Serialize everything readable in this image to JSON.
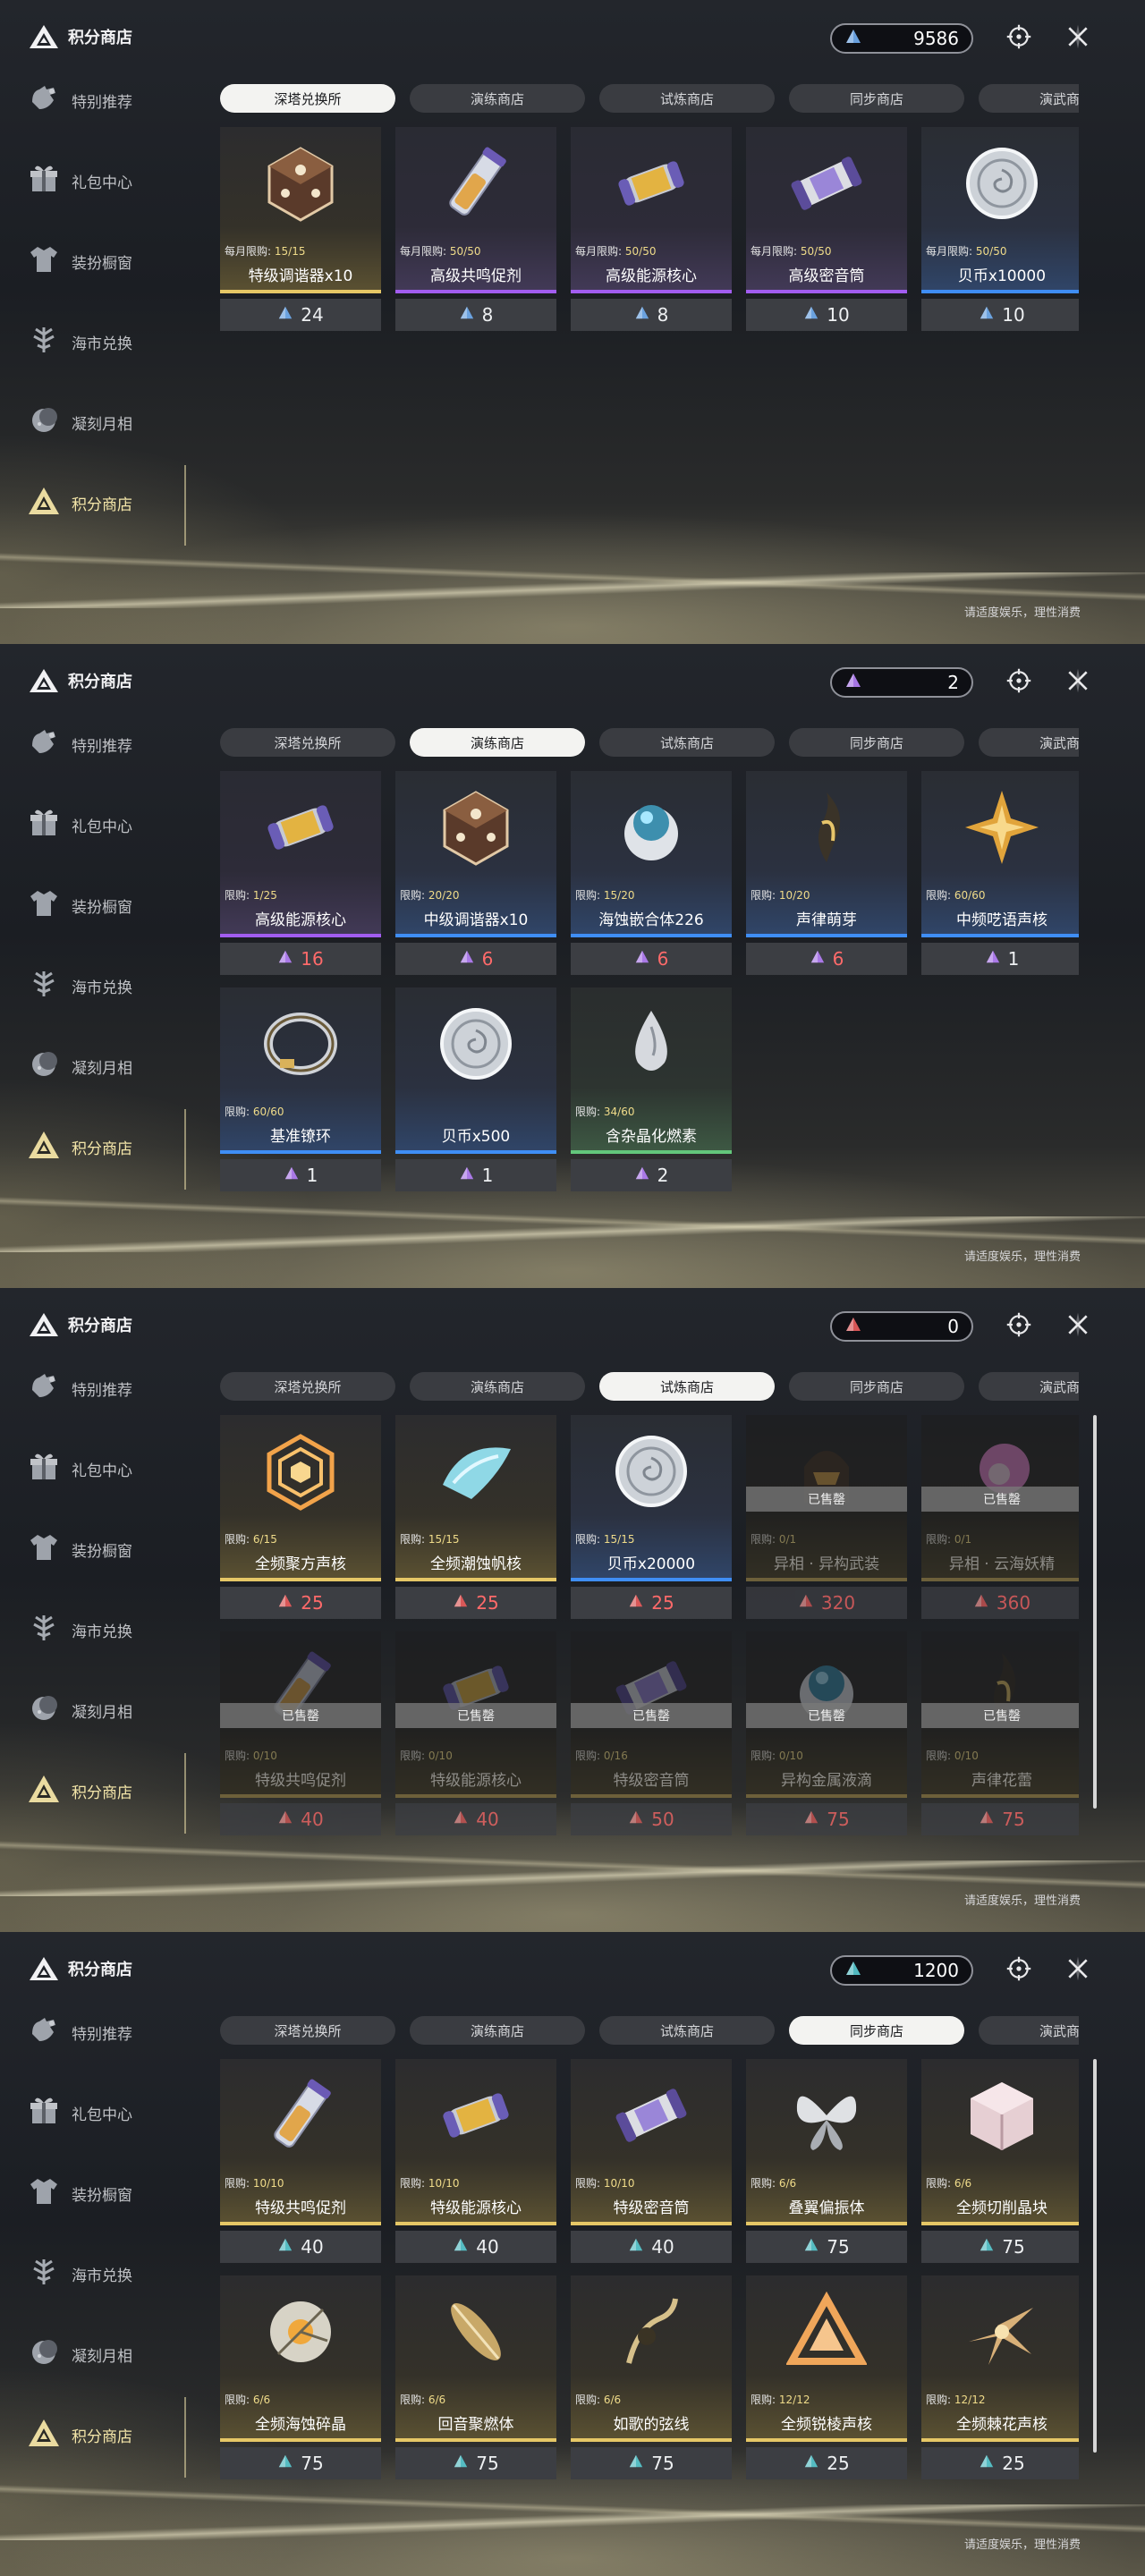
{
  "app": {
    "title": "积分商店",
    "footer": "请适度娱乐，理性消费",
    "sidebar": [
      {
        "label": "特别推荐",
        "icon": "hand-icon"
      },
      {
        "label": "礼包中心",
        "icon": "gift-icon"
      },
      {
        "label": "装扮橱窗",
        "icon": "shirt-icon"
      },
      {
        "label": "海市兑换",
        "icon": "tree-icon"
      },
      {
        "label": "凝刻月相",
        "icon": "moon-icon"
      },
      {
        "label": "积分商店",
        "icon": "triangle-icon"
      }
    ],
    "tabs": [
      "深塔兑换所",
      "演练商店",
      "试炼商店",
      "同步商店",
      "演武商店"
    ],
    "sold_out_label": "已售罄"
  },
  "colors": {
    "blue_currency": "#6ea8e8",
    "purple_currency": "#b07cf0",
    "red_currency": "#e25a5a",
    "teal_currency": "#56c3c9"
  },
  "screens": [
    {
      "active_tab": 0,
      "currency": {
        "value": "9586",
        "color": "blue"
      },
      "items": [
        {
          "limit_label": "每月限购:",
          "limit": "15/15",
          "name": "特级调谐器x10",
          "price": "24",
          "rarity": "gold",
          "art": "dice"
        },
        {
          "limit_label": "每月限购:",
          "limit": "50/50",
          "name": "高级共鸣促剂",
          "price": "8",
          "rarity": "purple",
          "art": "vial"
        },
        {
          "limit_label": "每月限购:",
          "limit": "50/50",
          "name": "高级能源核心",
          "price": "8",
          "rarity": "purple",
          "art": "capsule"
        },
        {
          "limit_label": "每月限购:",
          "limit": "50/50",
          "name": "高级密音筒",
          "price": "10",
          "rarity": "purple",
          "art": "tube"
        },
        {
          "limit_label": "每月限购:",
          "limit": "50/50",
          "name": "贝币x10000",
          "price": "10",
          "rarity": "blue",
          "art": "coin"
        }
      ]
    },
    {
      "active_tab": 1,
      "currency": {
        "value": "2",
        "color": "purple"
      },
      "items": [
        {
          "limit_label": "限购:",
          "limit": "1/25",
          "name": "高级能源核心",
          "price": "16",
          "rarity": "purple",
          "art": "capsule",
          "red": true
        },
        {
          "limit_label": "限购:",
          "limit": "20/20",
          "name": "中级调谐器x10",
          "price": "6",
          "rarity": "blue",
          "art": "dice",
          "red": true
        },
        {
          "limit_label": "限购:",
          "limit": "15/20",
          "name": "海蚀嵌合体226",
          "price": "6",
          "rarity": "blue",
          "art": "orb",
          "red": true
        },
        {
          "limit_label": "限购:",
          "limit": "10/20",
          "name": "声律萌芽",
          "price": "6",
          "rarity": "blue",
          "art": "sprout",
          "red": true
        },
        {
          "limit_label": "限购:",
          "limit": "60/60",
          "name": "中频呓语声核",
          "price": "1",
          "rarity": "blue",
          "art": "star"
        },
        {
          "limit_label": "限购:",
          "limit": "60/60",
          "name": "基准镣环",
          "price": "1",
          "rarity": "blue",
          "art": "ring"
        },
        {
          "limit_label": "",
          "limit": "",
          "name": "贝币x500",
          "price": "1",
          "rarity": "blue",
          "art": "coin"
        },
        {
          "limit_label": "限购:",
          "limit": "34/60",
          "name": "含杂晶化燃素",
          "price": "2",
          "rarity": "green",
          "art": "drop"
        }
      ]
    },
    {
      "active_tab": 2,
      "currency": {
        "value": "0",
        "color": "red"
      },
      "items": [
        {
          "limit_label": "限购:",
          "limit": "6/15",
          "name": "全频聚方声核",
          "price": "25",
          "rarity": "gold",
          "art": "hex",
          "red": true
        },
        {
          "limit_label": "限购:",
          "limit": "15/15",
          "name": "全频潮蚀帆核",
          "price": "25",
          "rarity": "gold",
          "art": "shell",
          "red": true
        },
        {
          "limit_label": "限购:",
          "limit": "15/15",
          "name": "贝币x20000",
          "price": "25",
          "rarity": "blue",
          "art": "coin",
          "red": true
        },
        {
          "limit_label": "限购:",
          "limit": "0/1",
          "name": "异相 · 异构武装",
          "price": "320",
          "rarity": "gold",
          "art": "helmet",
          "red": true,
          "sold": true
        },
        {
          "limit_label": "限购:",
          "limit": "0/1",
          "name": "异相 · 云海妖精",
          "price": "360",
          "rarity": "gold",
          "art": "fairy",
          "red": true,
          "sold": true
        },
        {
          "limit_label": "限购:",
          "limit": "0/10",
          "name": "特级共鸣促剂",
          "price": "40",
          "rarity": "gold",
          "art": "vial",
          "red": true,
          "sold": true
        },
        {
          "limit_label": "限购:",
          "limit": "0/10",
          "name": "特级能源核心",
          "price": "40",
          "rarity": "gold",
          "art": "capsule",
          "red": true,
          "sold": true
        },
        {
          "limit_label": "限购:",
          "limit": "0/16",
          "name": "特级密音筒",
          "price": "50",
          "rarity": "gold",
          "art": "tube",
          "red": true,
          "sold": true
        },
        {
          "limit_label": "限购:",
          "limit": "0/10",
          "name": "异构金属液滴",
          "price": "75",
          "rarity": "gold",
          "art": "orb",
          "red": true,
          "sold": true
        },
        {
          "limit_label": "限购:",
          "limit": "0/10",
          "name": "声律花蕾",
          "price": "75",
          "rarity": "gold",
          "art": "sprout",
          "red": true,
          "sold": true
        }
      ]
    },
    {
      "active_tab": 3,
      "currency": {
        "value": "1200",
        "color": "teal"
      },
      "items": [
        {
          "limit_label": "限购:",
          "limit": "10/10",
          "name": "特级共鸣促剂",
          "price": "40",
          "rarity": "gold",
          "art": "vial"
        },
        {
          "limit_label": "限购:",
          "limit": "10/10",
          "name": "特级能源核心",
          "price": "40",
          "rarity": "gold",
          "art": "capsule"
        },
        {
          "limit_label": "限购:",
          "limit": "10/10",
          "name": "特级密音筒",
          "price": "40",
          "rarity": "gold",
          "art": "tube"
        },
        {
          "limit_label": "限购:",
          "limit": "6/6",
          "name": "叠翼偏振体",
          "price": "75",
          "rarity": "gold",
          "art": "butterfly"
        },
        {
          "limit_label": "限购:",
          "limit": "6/6",
          "name": "全频切削晶块",
          "price": "75",
          "rarity": "gold",
          "art": "cube"
        },
        {
          "limit_label": "限购:",
          "limit": "6/6",
          "name": "全频海蚀碎晶",
          "price": "75",
          "rarity": "gold",
          "art": "shard"
        },
        {
          "limit_label": "限购:",
          "limit": "6/6",
          "name": "回音聚燃体",
          "price": "75",
          "rarity": "gold",
          "art": "feather"
        },
        {
          "limit_label": "限购:",
          "limit": "6/6",
          "name": "如歌的弦线",
          "price": "75",
          "rarity": "gold",
          "art": "string"
        },
        {
          "limit_label": "限购:",
          "limit": "12/12",
          "name": "全频锐棱声核",
          "price": "25",
          "rarity": "gold",
          "art": "triangle"
        },
        {
          "limit_label": "限购:",
          "limit": "12/12",
          "name": "全频棘花声核",
          "price": "25",
          "rarity": "gold",
          "art": "flower"
        }
      ]
    }
  ]
}
